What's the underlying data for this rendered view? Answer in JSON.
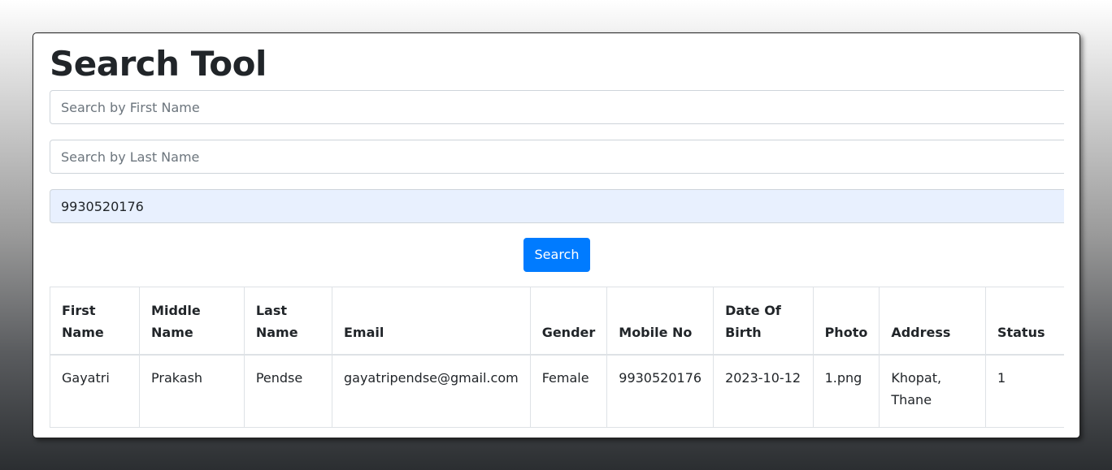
{
  "page": {
    "title": "Search Tool"
  },
  "form": {
    "first_name_placeholder": "Search by First Name",
    "last_name_placeholder": "Search by Last Name",
    "mobile_value": "9930520176",
    "search_label": "Search"
  },
  "table": {
    "headers": [
      "First Name",
      "Middle Name",
      "Last Name",
      "Email",
      "Gender",
      "Mobile No",
      "Date Of Birth",
      "Photo",
      "Address",
      "Status"
    ],
    "rows": [
      [
        "Gayatri",
        "Prakash",
        "Pendse",
        "gayatripendse@gmail.com",
        "Female",
        "9930520176",
        "2023-10-12",
        "1.png",
        "Khopat, Thane",
        "1"
      ]
    ]
  },
  "colors": {
    "primary": "#007bff",
    "autofill_bg": "#e8f0fe",
    "text": "#212529"
  }
}
